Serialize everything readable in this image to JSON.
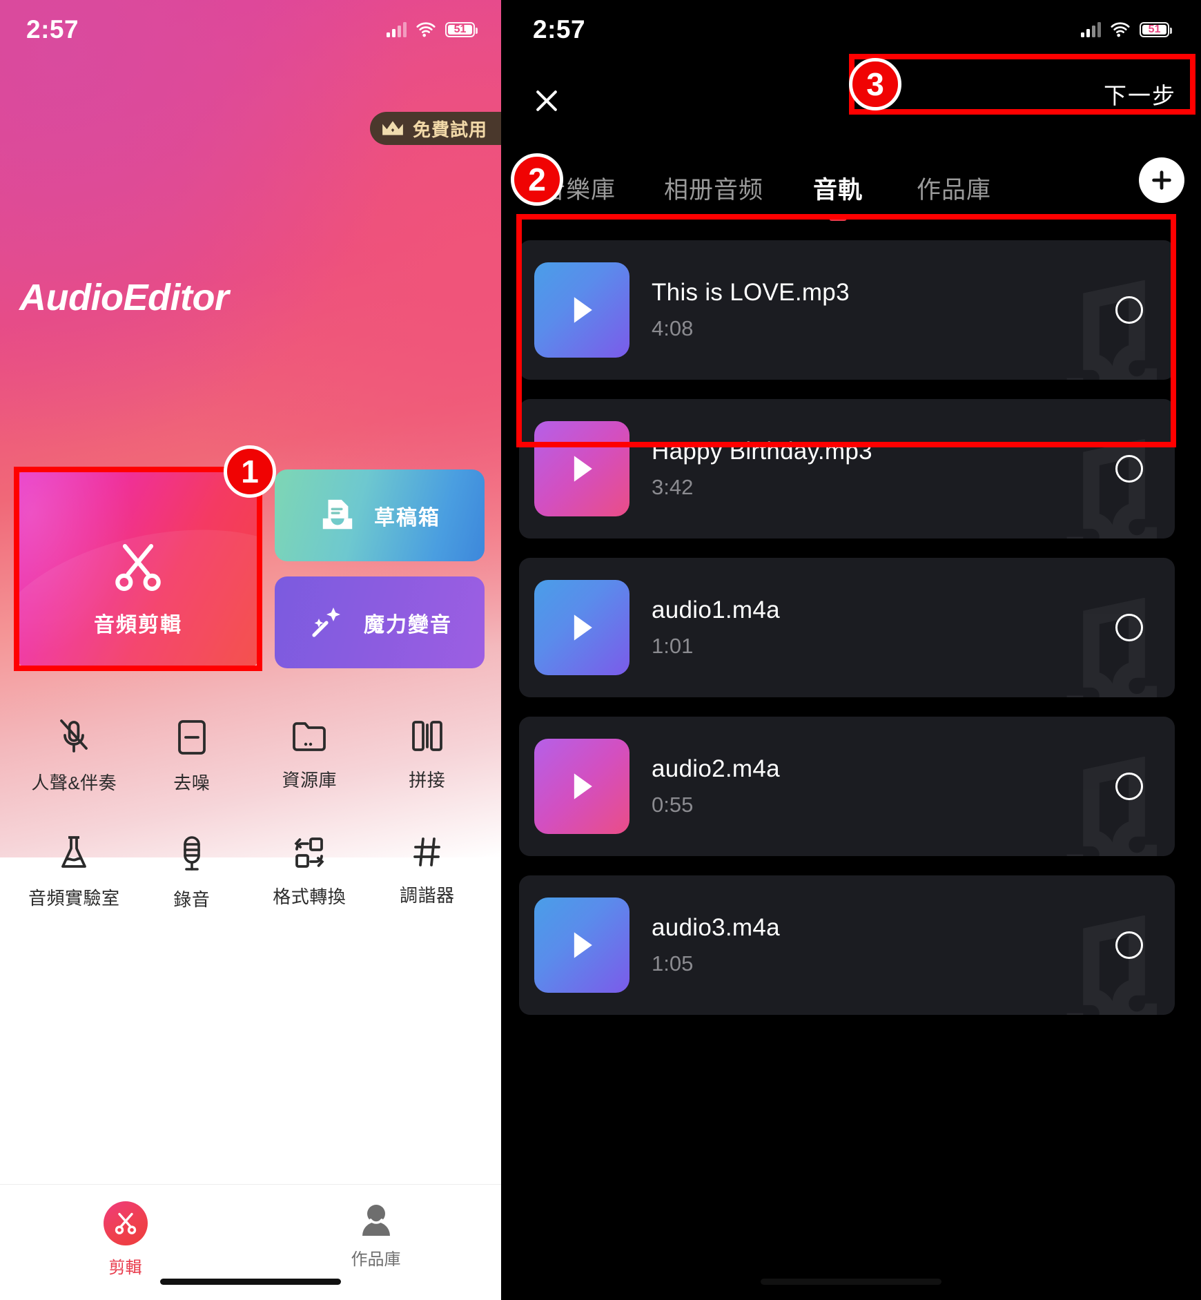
{
  "status_bar": {
    "time": "2:57",
    "battery": "51",
    "signal_icon": "cellular-bars-icon",
    "wifi_icon": "wifi-icon"
  },
  "left_screen": {
    "trial_badge": {
      "label": "免費試用",
      "icon": "crown-icon"
    },
    "brand_title": "AudioEditor",
    "cards": {
      "primary": {
        "label": "音頻剪輯",
        "icon": "scissors-icon"
      },
      "drafts": {
        "label": "草稿箱",
        "icon": "draft-inbox-icon"
      },
      "voice": {
        "label": "魔力變音",
        "icon": "magic-wand-icon"
      }
    },
    "tools": [
      {
        "label": "人聲&伴奏",
        "icon": "mic-muted-icon"
      },
      {
        "label": "去噪",
        "icon": "minus-box-icon"
      },
      {
        "label": "資源庫",
        "icon": "folder-icon"
      },
      {
        "label": "拼接",
        "icon": "splice-icon"
      },
      {
        "label": "音頻實驗室",
        "icon": "flask-icon"
      },
      {
        "label": "錄音",
        "icon": "microphone-icon"
      },
      {
        "label": "格式轉換",
        "icon": "format-convert-icon"
      },
      {
        "label": "調諧器",
        "icon": "tuner-icon"
      }
    ],
    "tabbar": [
      {
        "label": "剪輯",
        "icon": "scissors-circle-icon",
        "active": true
      },
      {
        "label": "作品庫",
        "icon": "person-icon",
        "active": false
      }
    ]
  },
  "right_screen": {
    "close_label": "✕",
    "next_button": "下一步",
    "add_button_icon": "plus-icon",
    "tabs": [
      {
        "label": "音樂庫",
        "active": false
      },
      {
        "label": "相册音频",
        "active": false
      },
      {
        "label": "音軌",
        "active": true
      },
      {
        "label": "作品庫",
        "active": false
      }
    ],
    "audio_items": [
      {
        "name": "This is LOVE.mp3",
        "duration": "4:08",
        "thumb": "g-blue",
        "selected": false
      },
      {
        "name": "Happy Birthday.mp3",
        "duration": "3:42",
        "thumb": "g-pink",
        "selected": false
      },
      {
        "name": "audio1.m4a",
        "duration": "1:01",
        "thumb": "g-blue",
        "selected": false
      },
      {
        "name": "audio2.m4a",
        "duration": "0:55",
        "thumb": "g-pink",
        "selected": false
      },
      {
        "name": "audio3.m4a",
        "duration": "1:05",
        "thumb": "g-blue",
        "selected": false
      }
    ]
  },
  "callouts": [
    {
      "number": "1"
    },
    {
      "number": "2"
    },
    {
      "number": "3"
    }
  ],
  "colors": {
    "accent_red": "#e8394a",
    "callout_red": "#f00303",
    "dark_bg": "#000000",
    "row_bg": "#1b1c21"
  }
}
